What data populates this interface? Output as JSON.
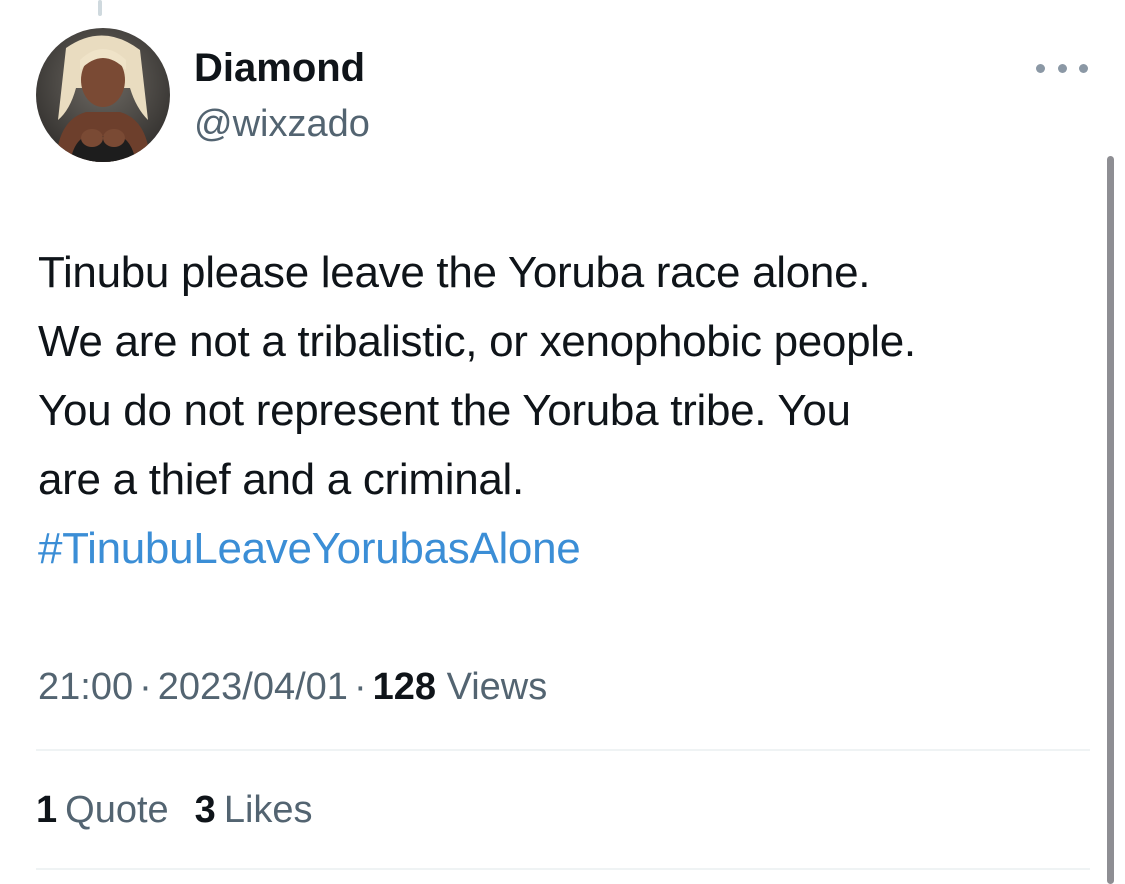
{
  "author": {
    "display_name": "Diamond",
    "handle": "@wixzado"
  },
  "icons": {
    "more": "more-horizontal-icon",
    "avatar": "profile-photo"
  },
  "tweet": {
    "lines": [
      "Tinubu please leave the Yoruba race alone.",
      "We are not a tribalistic, or xenophobic people.",
      "You do not represent the Yoruba tribe. You",
      "are a thief and a criminal."
    ],
    "hashtag": "#TinubuLeaveYorubasAlone"
  },
  "meta": {
    "time": "21:00",
    "separator": "·",
    "date": "2023/04/01",
    "views_count": "128",
    "views_label": "Views"
  },
  "stats": {
    "quotes_count": "1",
    "quotes_label": "Quote",
    "likes_count": "3",
    "likes_label": "Likes"
  },
  "colors": {
    "text": "#0f1419",
    "secondary": "#536471",
    "hashtag": "#3b8ed6",
    "divider": "#eff3f4"
  }
}
